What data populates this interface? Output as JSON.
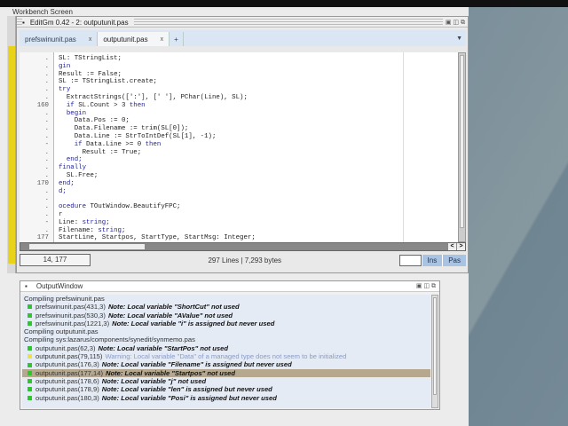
{
  "screen": {
    "title": "Workbench Screen"
  },
  "editor": {
    "title": "EditGm 0.42 - 2: outputunit.pas",
    "tabs": [
      {
        "label": "prefswinunit.pas",
        "close": "x"
      },
      {
        "label": "outputunit.pas",
        "close": "x"
      }
    ],
    "add_tab": "+",
    "code": [
      {
        "n": ".",
        "s": [
          [
            "SL: TStringList;",
            ""
          ]
        ]
      },
      {
        "n": ".",
        "s": [
          [
            "gin",
            "kw"
          ]
        ]
      },
      {
        "n": ".",
        "s": [
          [
            "Result := False;",
            ""
          ]
        ]
      },
      {
        "n": ".",
        "s": [
          [
            "SL := TStringList.create;",
            ""
          ]
        ]
      },
      {
        "n": ".",
        "s": [
          [
            "try",
            "kw"
          ]
        ]
      },
      {
        "n": ".",
        "s": [
          [
            "  ExtractStrings([':'], [' '], PChar(Line), SL);",
            ""
          ]
        ]
      },
      {
        "n": "160",
        "s": [
          [
            "  if ",
            "kw"
          ],
          [
            "SL.Count > 3 ",
            ""
          ],
          [
            "then",
            "kw"
          ]
        ]
      },
      {
        "n": ".",
        "s": [
          [
            "  begin",
            "kw"
          ]
        ]
      },
      {
        "n": ".",
        "s": [
          [
            "    Data.Pos := 0;",
            ""
          ]
        ]
      },
      {
        "n": ".",
        "s": [
          [
            "    Data.Filename := trim(SL[0]);",
            ""
          ]
        ]
      },
      {
        "n": ".",
        "s": [
          [
            "    Data.Line := StrToIntDef(SL[1], -1);",
            ""
          ]
        ]
      },
      {
        "n": "-",
        "s": [
          [
            "    if ",
            "kw"
          ],
          [
            "Data.Line >= 0 ",
            ""
          ],
          [
            "then",
            "kw"
          ]
        ]
      },
      {
        "n": ".",
        "s": [
          [
            "      Result := True;",
            ""
          ]
        ]
      },
      {
        "n": ".",
        "s": [
          [
            "  end;",
            "kw"
          ]
        ]
      },
      {
        "n": ".",
        "s": [
          [
            "finally",
            "kw"
          ]
        ]
      },
      {
        "n": ".",
        "s": [
          [
            "  SL.Free;",
            ""
          ]
        ]
      },
      {
        "n": "170",
        "s": [
          [
            "end;",
            "kw"
          ]
        ]
      },
      {
        "n": ".",
        "s": [
          [
            "d;",
            "kw"
          ]
        ]
      },
      {
        "n": ".",
        "s": [
          [
            "",
            ""
          ]
        ]
      },
      {
        "n": ".",
        "s": [
          [
            "ocedure ",
            "kw"
          ],
          [
            "TOutWindow.BeautifyFPC;",
            ""
          ]
        ]
      },
      {
        "n": ".",
        "s": [
          [
            "r",
            "kw"
          ]
        ]
      },
      {
        "n": "-",
        "s": [
          [
            "Line: ",
            ""
          ],
          [
            "string;",
            "kw"
          ]
        ]
      },
      {
        "n": ".",
        "s": [
          [
            "Filename: ",
            ""
          ],
          [
            "string;",
            "kw"
          ]
        ]
      },
      {
        "n": "177",
        "s": [
          [
            "StartLine, Startpos, StartType, StartMsg: Integer;",
            ""
          ]
        ]
      }
    ],
    "status": {
      "position": "14, 177",
      "info": "297 Lines | 7,293 bytes",
      "ins": "Ins",
      "pas": "Pas"
    }
  },
  "output": {
    "title": "OutputWindow",
    "messages": [
      {
        "type": "header",
        "text": "Compiling prefswinunit.pas"
      },
      {
        "type": "note",
        "loc": "prefswinunit.pas(431,3)",
        "msg": "Note: Local variable \"ShortCut\" not used"
      },
      {
        "type": "note",
        "loc": "prefswinunit.pas(530,3)",
        "msg": "Note: Local variable \"AValue\" not used"
      },
      {
        "type": "note",
        "loc": "prefswinunit.pas(1221,3)",
        "msg": "Note: Local variable \"i\" is assigned but never used"
      },
      {
        "type": "header",
        "text": "Compiling outputunit.pas"
      },
      {
        "type": "header",
        "text": "Compiling sys:lazarus/components/synedit/synmemo.pas"
      },
      {
        "type": "note",
        "loc": "outputunit.pas(62,3)",
        "msg": "Note: Local variable \"StartPos\" not used"
      },
      {
        "type": "warn",
        "loc": "outputunit.pas(79,115)",
        "msg": "Warning: Local variable \"Data\" of a managed type does not seem to be initialized"
      },
      {
        "type": "note",
        "loc": "outputunit.pas(176,3)",
        "msg": "Note: Local variable \"Filename\" is assigned but never used"
      },
      {
        "type": "sel",
        "loc": "outputunit.pas(177,14)",
        "msg": "Note: Local variable \"Startpos\" not used"
      },
      {
        "type": "note",
        "loc": "outputunit.pas(178,6)",
        "msg": "Note: Local variable \"j\" not used"
      },
      {
        "type": "note",
        "loc": "outputunit.pas(178,9)",
        "msg": "Note: Local variable \"len\" is assigned but never used"
      },
      {
        "type": "note",
        "loc": "outputunit.pas(180,3)",
        "msg": "Note: Local variable \"Posi\" is assigned but never used"
      }
    ]
  }
}
